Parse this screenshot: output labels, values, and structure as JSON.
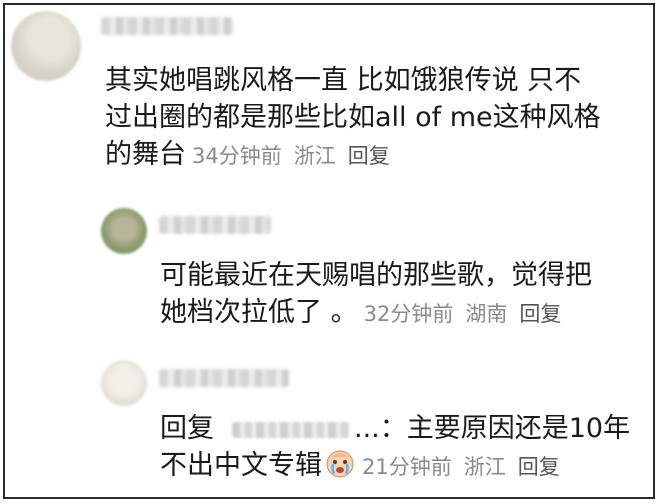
{
  "comments": [
    {
      "text_line1": "其实她唱跳风格一直 比如饿狼传说 只不",
      "text_line2": "过出圈的都是那些比如all of me这种风格",
      "text_line3": "的舞台",
      "time": "34分钟前",
      "location": "浙江",
      "reply": "回复"
    },
    {
      "text_line1": "可能最近在天赐唱的那些歌，觉得把",
      "text_line2": "她档次拉低了 。",
      "time": "32分钟前",
      "location": "湖南",
      "reply": "回复"
    },
    {
      "reply_prefix": "回复",
      "reply_suffix": "...：主要原因还是10年",
      "text_line2": "不出中文专辑",
      "time": "21分钟前",
      "location": "浙江",
      "reply": "回复"
    }
  ],
  "icons": {
    "emoji": "crying-face-emoji"
  },
  "colors": {
    "text": "#1a1a1a",
    "meta": "#8a8a8a",
    "border": "#2a2a2a"
  }
}
